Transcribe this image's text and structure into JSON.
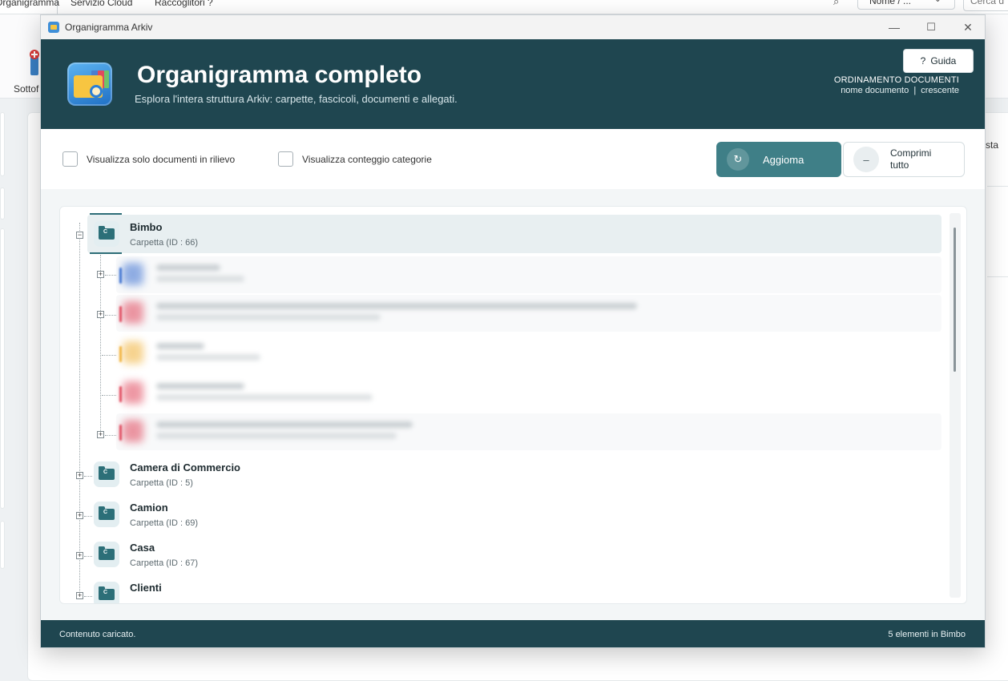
{
  "background_app": {
    "tabs": [
      "Organigramma",
      "Servizio Cloud",
      "Raccoglitori ?"
    ],
    "search_select_value": "Nome / ...",
    "search_placeholder": "Cerca d",
    "ribbon_label": "Sottof",
    "right_label": "sta"
  },
  "window": {
    "title": "Organigramma Arkiv",
    "controls": {
      "minimize": "—",
      "maximize": "☐",
      "close": "✕"
    }
  },
  "header": {
    "title": "Organigramma completo",
    "subtitle": "Esplora l'intera struttura Arkiv: carpette, fascicoli, documenti e allegati.",
    "guide_button": "Guida",
    "guide_icon": "?",
    "sort_title": "ORDINAMENTO DOCUMENTI",
    "sort_field": "nome documento",
    "sort_separator": "|",
    "sort_direction": "crescente"
  },
  "toolbar": {
    "check_highlight": "Visualizza solo documenti in rilievo",
    "check_count": "Visualizza conteggio categorie",
    "refresh_button": "Aggioma",
    "refresh_icon": "↻",
    "collapse_button": "Comprimi tutto",
    "collapse_icon": "–"
  },
  "tree": {
    "nodes": [
      {
        "name": "Bimbo",
        "sub": "Carpetta (ID : 66)",
        "letter": "C",
        "expanded": true,
        "selected": true
      },
      {
        "name": "Camera di Commercio",
        "sub": "Carpetta (ID : 5)",
        "letter": "C",
        "expanded": false
      },
      {
        "name": "Camion",
        "sub": "Carpetta (ID : 69)",
        "letter": "C",
        "expanded": false
      },
      {
        "name": "Casa",
        "sub": "Carpetta (ID : 67)",
        "letter": "C",
        "expanded": false
      },
      {
        "name": "Clienti",
        "sub": "",
        "letter": "C",
        "expanded": false
      }
    ],
    "expander_plus": "+",
    "expander_minus": "−",
    "blurred_children_colors": [
      "#3a6fd0",
      "#e0455a",
      "#f0b035",
      "#e0455a",
      "#e0455a"
    ]
  },
  "status": {
    "left": "Contenuto caricato.",
    "right": "5 elementi in Bimbo"
  },
  "colors": {
    "header_bg": "#1f4650",
    "accent_button": "#3f7f87",
    "folder": "#2c6f78"
  }
}
